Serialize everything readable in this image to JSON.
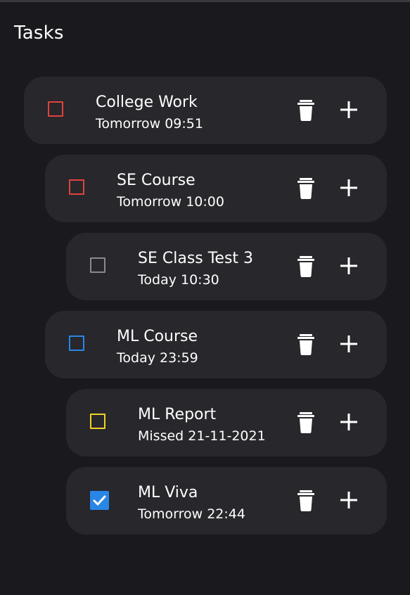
{
  "header": {
    "title": "Tasks"
  },
  "colors": {
    "background": "#1a1a1e",
    "card": "#27272c",
    "priority_high": "#e0433d",
    "priority_none": "#8a8a8e",
    "priority_medium": "#2a86e6",
    "priority_low": "#f2d224",
    "checked": "#2a86e6"
  },
  "tasks": [
    {
      "name": "College Work",
      "due": "Tomorrow 09:51",
      "level": 0,
      "checkbox_color": "#e0433d",
      "checked": false,
      "delete_icon": "trash-icon",
      "add_icon": "plus-icon"
    },
    {
      "name": "SE Course",
      "due": "Tomorrow 10:00",
      "level": 1,
      "checkbox_color": "#e0433d",
      "checked": false,
      "delete_icon": "trash-icon",
      "add_icon": "plus-icon"
    },
    {
      "name": "SE Class Test 3",
      "due": "Today 10:30",
      "level": 2,
      "checkbox_color": "#8a8a8e",
      "checked": false,
      "delete_icon": "trash-icon",
      "add_icon": "plus-icon"
    },
    {
      "name": "ML Course",
      "due": "Today 23:59",
      "level": 1,
      "checkbox_color": "#2a86e6",
      "checked": false,
      "delete_icon": "trash-icon",
      "add_icon": "plus-icon"
    },
    {
      "name": "ML Report",
      "due": "Missed 21-11-2021",
      "level": 2,
      "checkbox_color": "#f2d224",
      "checked": false,
      "delete_icon": "trash-icon",
      "add_icon": "plus-icon"
    },
    {
      "name": "ML Viva",
      "due": "Tomorrow 22:44",
      "level": 2,
      "checkbox_color": "#2a86e6",
      "checked": true,
      "delete_icon": "trash-icon",
      "add_icon": "plus-icon"
    }
  ]
}
